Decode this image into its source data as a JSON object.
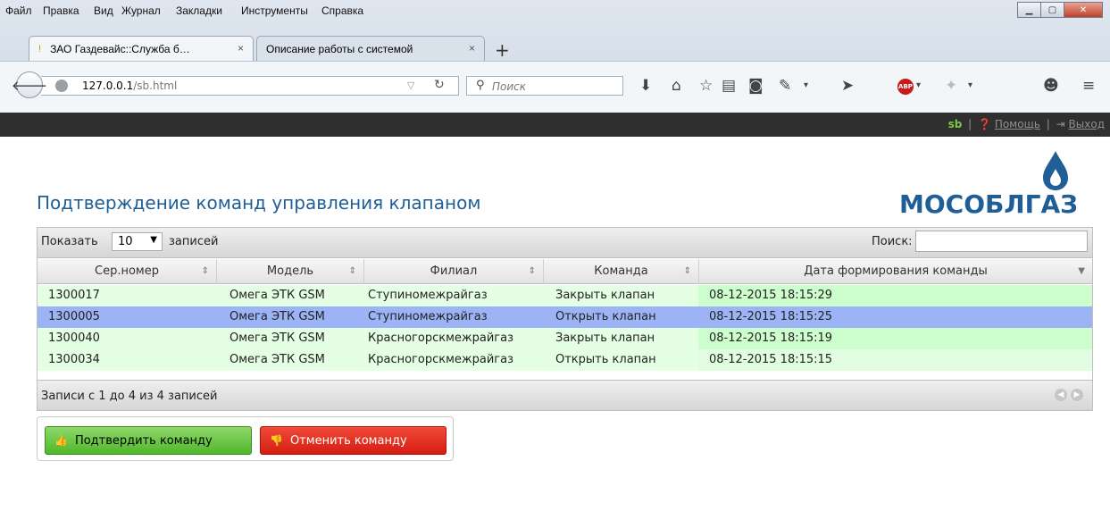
{
  "browser": {
    "menu": [
      "Файл",
      "Правка",
      "Вид",
      "Журнал",
      "Закладки",
      "Инструменты",
      "Справка"
    ],
    "tabs": [
      {
        "title": "ЗАО Газдевайс::Служба б…",
        "close": "×"
      },
      {
        "title": "Описание работы с системой",
        "close": "×"
      }
    ],
    "new_tab": "+",
    "url_host": "127.0.0.1",
    "url_path": "/sb.html",
    "search_placeholder": "Поиск",
    "abp_label": "ABP"
  },
  "header": {
    "user": "sb",
    "help": "Помощь",
    "logout": "Выход",
    "separator": "|"
  },
  "page": {
    "title": "Подтверждение команд управления клапаном",
    "logo_text": "МОСОБЛГАЗ"
  },
  "table": {
    "length_prefix": "Показать",
    "length_value": "10",
    "length_suffix": "записей",
    "search_label": "Поиск:",
    "columns": [
      "Сер.номер",
      "Модель",
      "Филиал",
      "Команда",
      "Дата формирования команды"
    ],
    "rows": [
      [
        "1300017",
        "Омега ЭТК GSM",
        "Ступиномежрайгаз",
        "Закрыть клапан",
        "08-12-2015 18:15:29"
      ],
      [
        "1300005",
        "Омега ЭТК GSM",
        "Ступиномежрайгаз",
        "Открыть клапан",
        "08-12-2015 18:15:25"
      ],
      [
        "1300040",
        "Омега ЭТК GSM",
        "Красногорскмежрайгаз",
        "Закрыть клапан",
        "08-12-2015 18:15:19"
      ],
      [
        "1300034",
        "Омега ЭТК GSM",
        "Красногорскмежрайгаз",
        "Открыть клапан",
        "08-12-2015 18:15:15"
      ]
    ],
    "selected_row": 1,
    "info": "Записи с 1 до 4 из 4 записей"
  },
  "buttons": {
    "confirm": "Подтвердить команду",
    "cancel": "Отменить команду"
  },
  "colors": {
    "title_blue": "#1f5e96",
    "row_green": "#cdfecd",
    "row_selected": "#9cb4f6",
    "confirm_green": "#4fb72a",
    "cancel_red": "#d51d12"
  }
}
